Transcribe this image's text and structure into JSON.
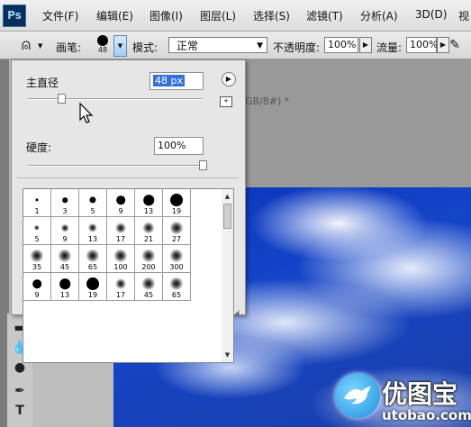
{
  "app": {
    "logo_text": "Ps"
  },
  "menu": [
    "文件(F)",
    "编辑(E)",
    "图像(I)",
    "图层(L)",
    "选择(S)",
    "滤镜(T)",
    "分析(A)",
    "3D(D)",
    "视"
  ],
  "options_bar": {
    "tool_icon": "stamp-icon",
    "brush_label": "画笔:",
    "brush_size_preview": "48",
    "mode_label": "模式:",
    "mode_value": "正常",
    "opacity_label": "不透明度:",
    "opacity_value": "100%",
    "flow_label": "流量:",
    "flow_value": "100%"
  },
  "document": {
    "tab_text": "GB/8#) *"
  },
  "brush_popup": {
    "master_diameter_label": "主直径",
    "master_diameter_value": "48 px",
    "master_diameter_fraction": 0.19,
    "hardness_label": "硬度:",
    "hardness_value": "100%",
    "hardness_fraction": 1.0,
    "presets": [
      {
        "size": "1",
        "style": "hard"
      },
      {
        "size": "3",
        "style": "hard"
      },
      {
        "size": "5",
        "style": "hard"
      },
      {
        "size": "9",
        "style": "hard"
      },
      {
        "size": "13",
        "style": "hard"
      },
      {
        "size": "19",
        "style": "hard"
      },
      {
        "size": "5",
        "style": "soft"
      },
      {
        "size": "9",
        "style": "soft"
      },
      {
        "size": "13",
        "style": "soft"
      },
      {
        "size": "17",
        "style": "soft"
      },
      {
        "size": "21",
        "style": "soft"
      },
      {
        "size": "27",
        "style": "soft"
      },
      {
        "size": "35",
        "style": "soft"
      },
      {
        "size": "45",
        "style": "soft"
      },
      {
        "size": "65",
        "style": "soft"
      },
      {
        "size": "100",
        "style": "soft"
      },
      {
        "size": "200",
        "style": "soft"
      },
      {
        "size": "300",
        "style": "soft"
      },
      {
        "size": "9",
        "style": "hard"
      },
      {
        "size": "13",
        "style": "hard"
      },
      {
        "size": "19",
        "style": "hard"
      },
      {
        "size": "17",
        "style": "soft"
      },
      {
        "size": "45",
        "style": "soft"
      },
      {
        "size": "65",
        "style": "soft"
      }
    ]
  },
  "watermark": {
    "title": "优图宝",
    "url": "utobao.com"
  }
}
